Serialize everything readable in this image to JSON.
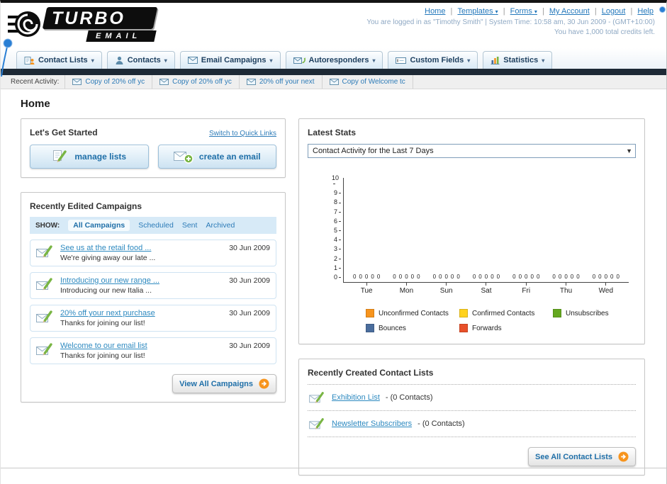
{
  "icons": {
    "dropdown_arrow": "▾",
    "select_arrow": "▼"
  },
  "header": {
    "logo_top": "TURBO",
    "logo_bottom": "EMAIL",
    "separator": "|",
    "links": [
      "Home",
      "Templates",
      "Forms",
      "My Account",
      "Logout",
      "Help"
    ],
    "session_line": "You are logged in as \"Timothy Smith\" | System Time: 10:58 am, 30 Jun 2009 - (GMT+10:00)",
    "credits_line": "You have 1,000 total credits left."
  },
  "nav": {
    "items": [
      "Contact Lists",
      "Contacts",
      "Email Campaigns",
      "Autoresponders",
      "Custom Fields",
      "Statistics"
    ]
  },
  "recent_activity": {
    "label": "Recent Activity:",
    "items": [
      "Copy of 20% off yc",
      "Copy of 20% off yc",
      "20% off your next",
      "Copy of Welcome tc"
    ]
  },
  "page": {
    "title": "Home"
  },
  "get_started": {
    "title": "Let's Get Started",
    "switch_link": "Switch to Quick Links",
    "manage_lists_label": "manage lists",
    "create_email_label": "create an email"
  },
  "campaigns": {
    "title": "Recently Edited Campaigns",
    "show_label": "SHOW:",
    "tabs": [
      "All Campaigns",
      "Scheduled",
      "Sent",
      "Archived"
    ],
    "items": [
      {
        "title": "See us at the retail food ...",
        "subtitle": "We're giving away our late ...",
        "date": "30 Jun 2009"
      },
      {
        "title": "Introducing our new range ...",
        "subtitle": "Introducing our new Italia ...",
        "date": "30 Jun 2009"
      },
      {
        "title": "20% off your next purchase",
        "subtitle": "Thanks for joining our list!",
        "date": "30 Jun 2009"
      },
      {
        "title": "Welcome to our email list",
        "subtitle": "Thanks for joining our list!",
        "date": "30 Jun 2009"
      }
    ],
    "view_all_label": "View All Campaigns"
  },
  "stats": {
    "title": "Latest Stats",
    "period_selected": "Contact Activity for the Last 7 Days",
    "chart_data": {
      "type": "bar",
      "title": "Contact Activity for the Last 7 Days",
      "categories": [
        "Tue",
        "Mon",
        "Sun",
        "Sat",
        "Fri",
        "Thu",
        "Wed"
      ],
      "series": [
        {
          "name": "Unconfirmed Contacts",
          "color": "#f7941d",
          "values": [
            0,
            0,
            0,
            0,
            0,
            0,
            0
          ]
        },
        {
          "name": "Confirmed Contacts",
          "color": "#ffd21e",
          "values": [
            0,
            0,
            0,
            0,
            0,
            0,
            0
          ]
        },
        {
          "name": "Unsubscribes",
          "color": "#64a81f",
          "values": [
            0,
            0,
            0,
            0,
            0,
            0,
            0
          ]
        },
        {
          "name": "Bounces",
          "color": "#4a6d9d",
          "values": [
            0,
            0,
            0,
            0,
            0,
            0,
            0
          ]
        },
        {
          "name": "Forwards",
          "color": "#e8502a",
          "values": [
            0,
            0,
            0,
            0,
            0,
            0,
            0
          ]
        }
      ],
      "ylim": [
        0,
        10
      ],
      "yticks": [
        0,
        1,
        2,
        3,
        4,
        5,
        6,
        7,
        8,
        9,
        10
      ],
      "xlabel": "",
      "ylabel": "",
      "grid": false,
      "legend_position": "bottom"
    }
  },
  "contact_lists": {
    "title": "Recently Created Contact Lists",
    "items": [
      {
        "name": "Exhibition List",
        "meta": "- (0 Contacts)"
      },
      {
        "name": "Newsletter Subscribers",
        "meta": "- (0 Contacts)"
      }
    ],
    "see_all_label": "See All Contact Lists"
  }
}
